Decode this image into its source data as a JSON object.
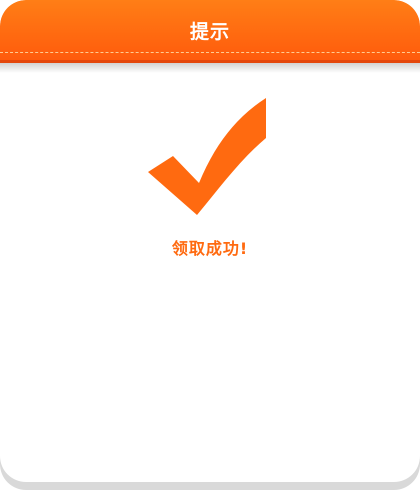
{
  "dialog": {
    "title": "提示",
    "message": "领取成功!",
    "icon": "checkmark-icon",
    "accent_color": "#ff6a10"
  }
}
